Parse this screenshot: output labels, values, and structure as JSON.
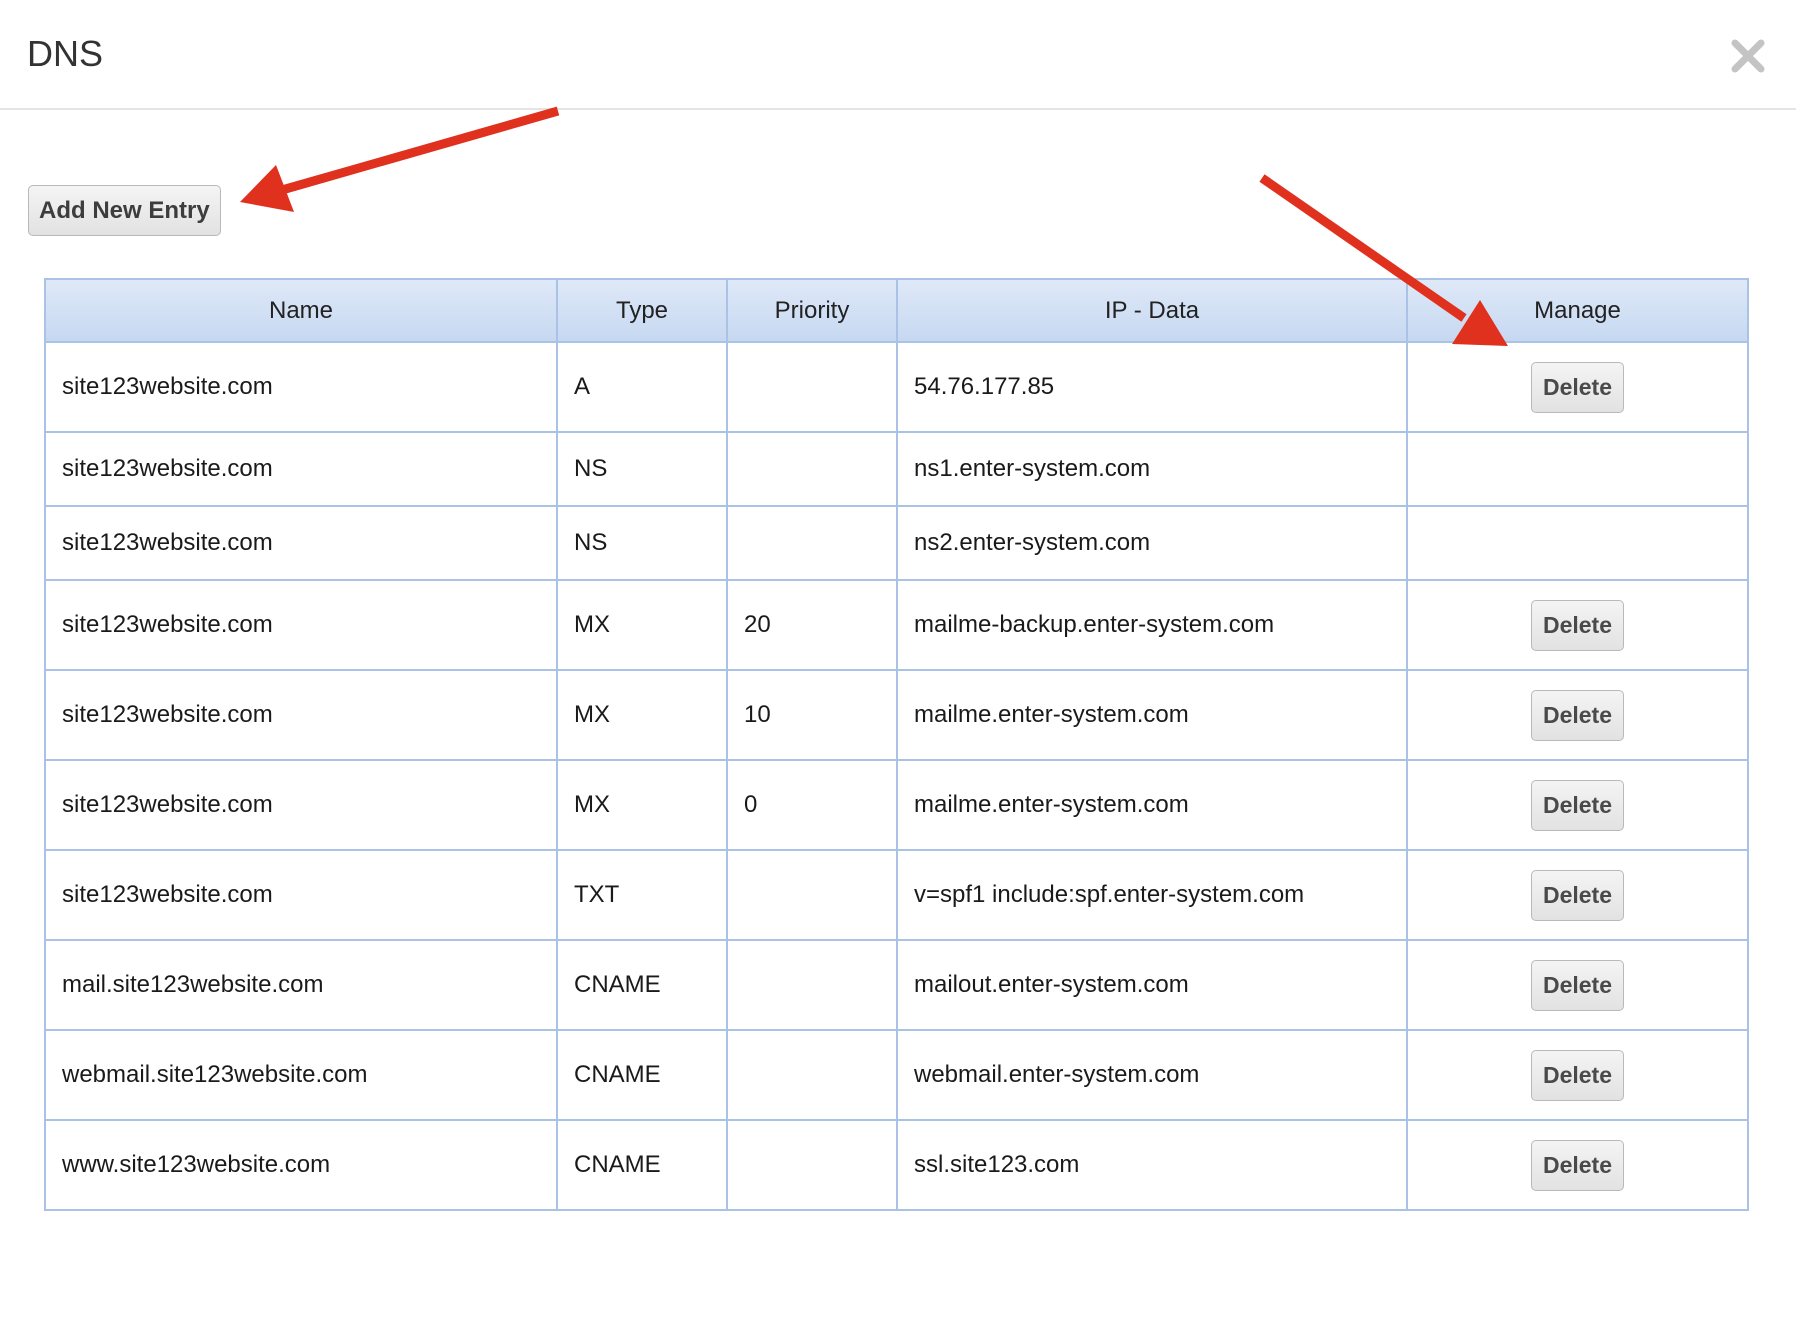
{
  "dialog": {
    "title": "DNS",
    "close_icon": "close-icon"
  },
  "toolbar": {
    "add_label": "Add New Entry"
  },
  "table": {
    "headers": {
      "name": "Name",
      "type": "Type",
      "priority": "Priority",
      "data": "IP - Data",
      "manage": "Manage"
    },
    "delete_label": "Delete",
    "rows": [
      {
        "name": "site123website.com",
        "type": "A",
        "priority": "",
        "data": "54.76.177.85",
        "deletable": true
      },
      {
        "name": "site123website.com",
        "type": "NS",
        "priority": "",
        "data": "ns1.enter-system.com",
        "deletable": false
      },
      {
        "name": "site123website.com",
        "type": "NS",
        "priority": "",
        "data": "ns2.enter-system.com",
        "deletable": false
      },
      {
        "name": "site123website.com",
        "type": "MX",
        "priority": "20",
        "data": "mailme-backup.enter-system.com",
        "deletable": true
      },
      {
        "name": "site123website.com",
        "type": "MX",
        "priority": "10",
        "data": "mailme.enter-system.com",
        "deletable": true
      },
      {
        "name": "site123website.com",
        "type": "MX",
        "priority": "0",
        "data": "mailme.enter-system.com",
        "deletable": true
      },
      {
        "name": "site123website.com",
        "type": "TXT",
        "priority": "",
        "data": "v=spf1 include:spf.enter-system.com",
        "deletable": true
      },
      {
        "name": "mail.site123website.com",
        "type": "CNAME",
        "priority": "",
        "data": "mailout.enter-system.com",
        "deletable": true
      },
      {
        "name": "webmail.site123website.com",
        "type": "CNAME",
        "priority": "",
        "data": "webmail.enter-system.com",
        "deletable": true
      },
      {
        "name": "www.site123website.com",
        "type": "CNAME",
        "priority": "",
        "data": "ssl.site123.com",
        "deletable": true
      }
    ]
  },
  "annotations": {
    "arrow_color": "#e0301e"
  }
}
